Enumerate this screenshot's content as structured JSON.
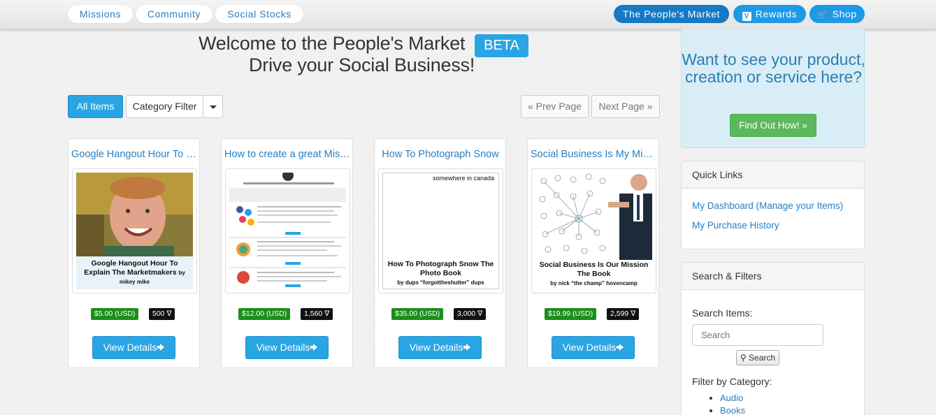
{
  "nav": {
    "left": [
      {
        "label": "Missions"
      },
      {
        "label": "Community"
      },
      {
        "label": "Social Stocks"
      }
    ],
    "market_label": "The People's Market",
    "rewards_label": "Rewards",
    "shop_label": "Shop"
  },
  "header": {
    "title": "Welcome to the People's Market",
    "badge": "BETA",
    "subtitle": "Drive your Social Business!"
  },
  "toolbar": {
    "all_items": "All Items",
    "category_filter": "Category Filter",
    "prev_page": "« Prev Page",
    "next_page": "Next Page »"
  },
  "items": [
    {
      "title": "Google Hangout Hour To Explain The Marketmakers",
      "thumb_caption": "Google Hangout Hour To Explain The Marketmakers",
      "thumb_author": "by mikey mike",
      "price_usd": "$5.00 (USD)",
      "price_points": "500",
      "view_label": "View Details"
    },
    {
      "title": "How to create a great Mission",
      "thumb_caption": "",
      "thumb_author": "",
      "price_usd": "$12.00 (USD)",
      "price_points": "1,560",
      "view_label": "View Details"
    },
    {
      "title": "How To Photograph Snow",
      "thumb_caption": "How To Photograph Snow The Photo Book",
      "thumb_author": "by dups “forgottheshutter” dups",
      "thumb_topline": "somewhere in canada",
      "price_usd": "$35.00 (USD)",
      "price_points": "3,000",
      "view_label": "View Details"
    },
    {
      "title": "Social Business Is My Mission",
      "thumb_caption": "Social Business Is Our Mission The Book",
      "thumb_author": "by nick “the champ” hovencamp",
      "price_usd": "$19.99 (USD)",
      "price_points": "2,599",
      "view_label": "View Details"
    }
  ],
  "promo": {
    "text": "Want to see your product, creation or service here?",
    "button": "Find Out How! »"
  },
  "quick_links": {
    "heading": "Quick Links",
    "links": [
      "My Dashboard (Manage your Items)",
      "My Purchase History"
    ]
  },
  "search_filters": {
    "heading": "Search & Filters",
    "search_label": "Search Items:",
    "search_placeholder": "Search",
    "search_button": "Search",
    "filter_label": "Filter by Category:",
    "categories": [
      "Audio",
      "Books"
    ]
  },
  "colors": {
    "accent": "#2aa5e4",
    "nav_dark": "#1579c4",
    "usd_badge": "#1b8f1b",
    "points_badge": "#111111",
    "promo_bg": "#d9edf7",
    "promo_button": "#5cb85c"
  }
}
